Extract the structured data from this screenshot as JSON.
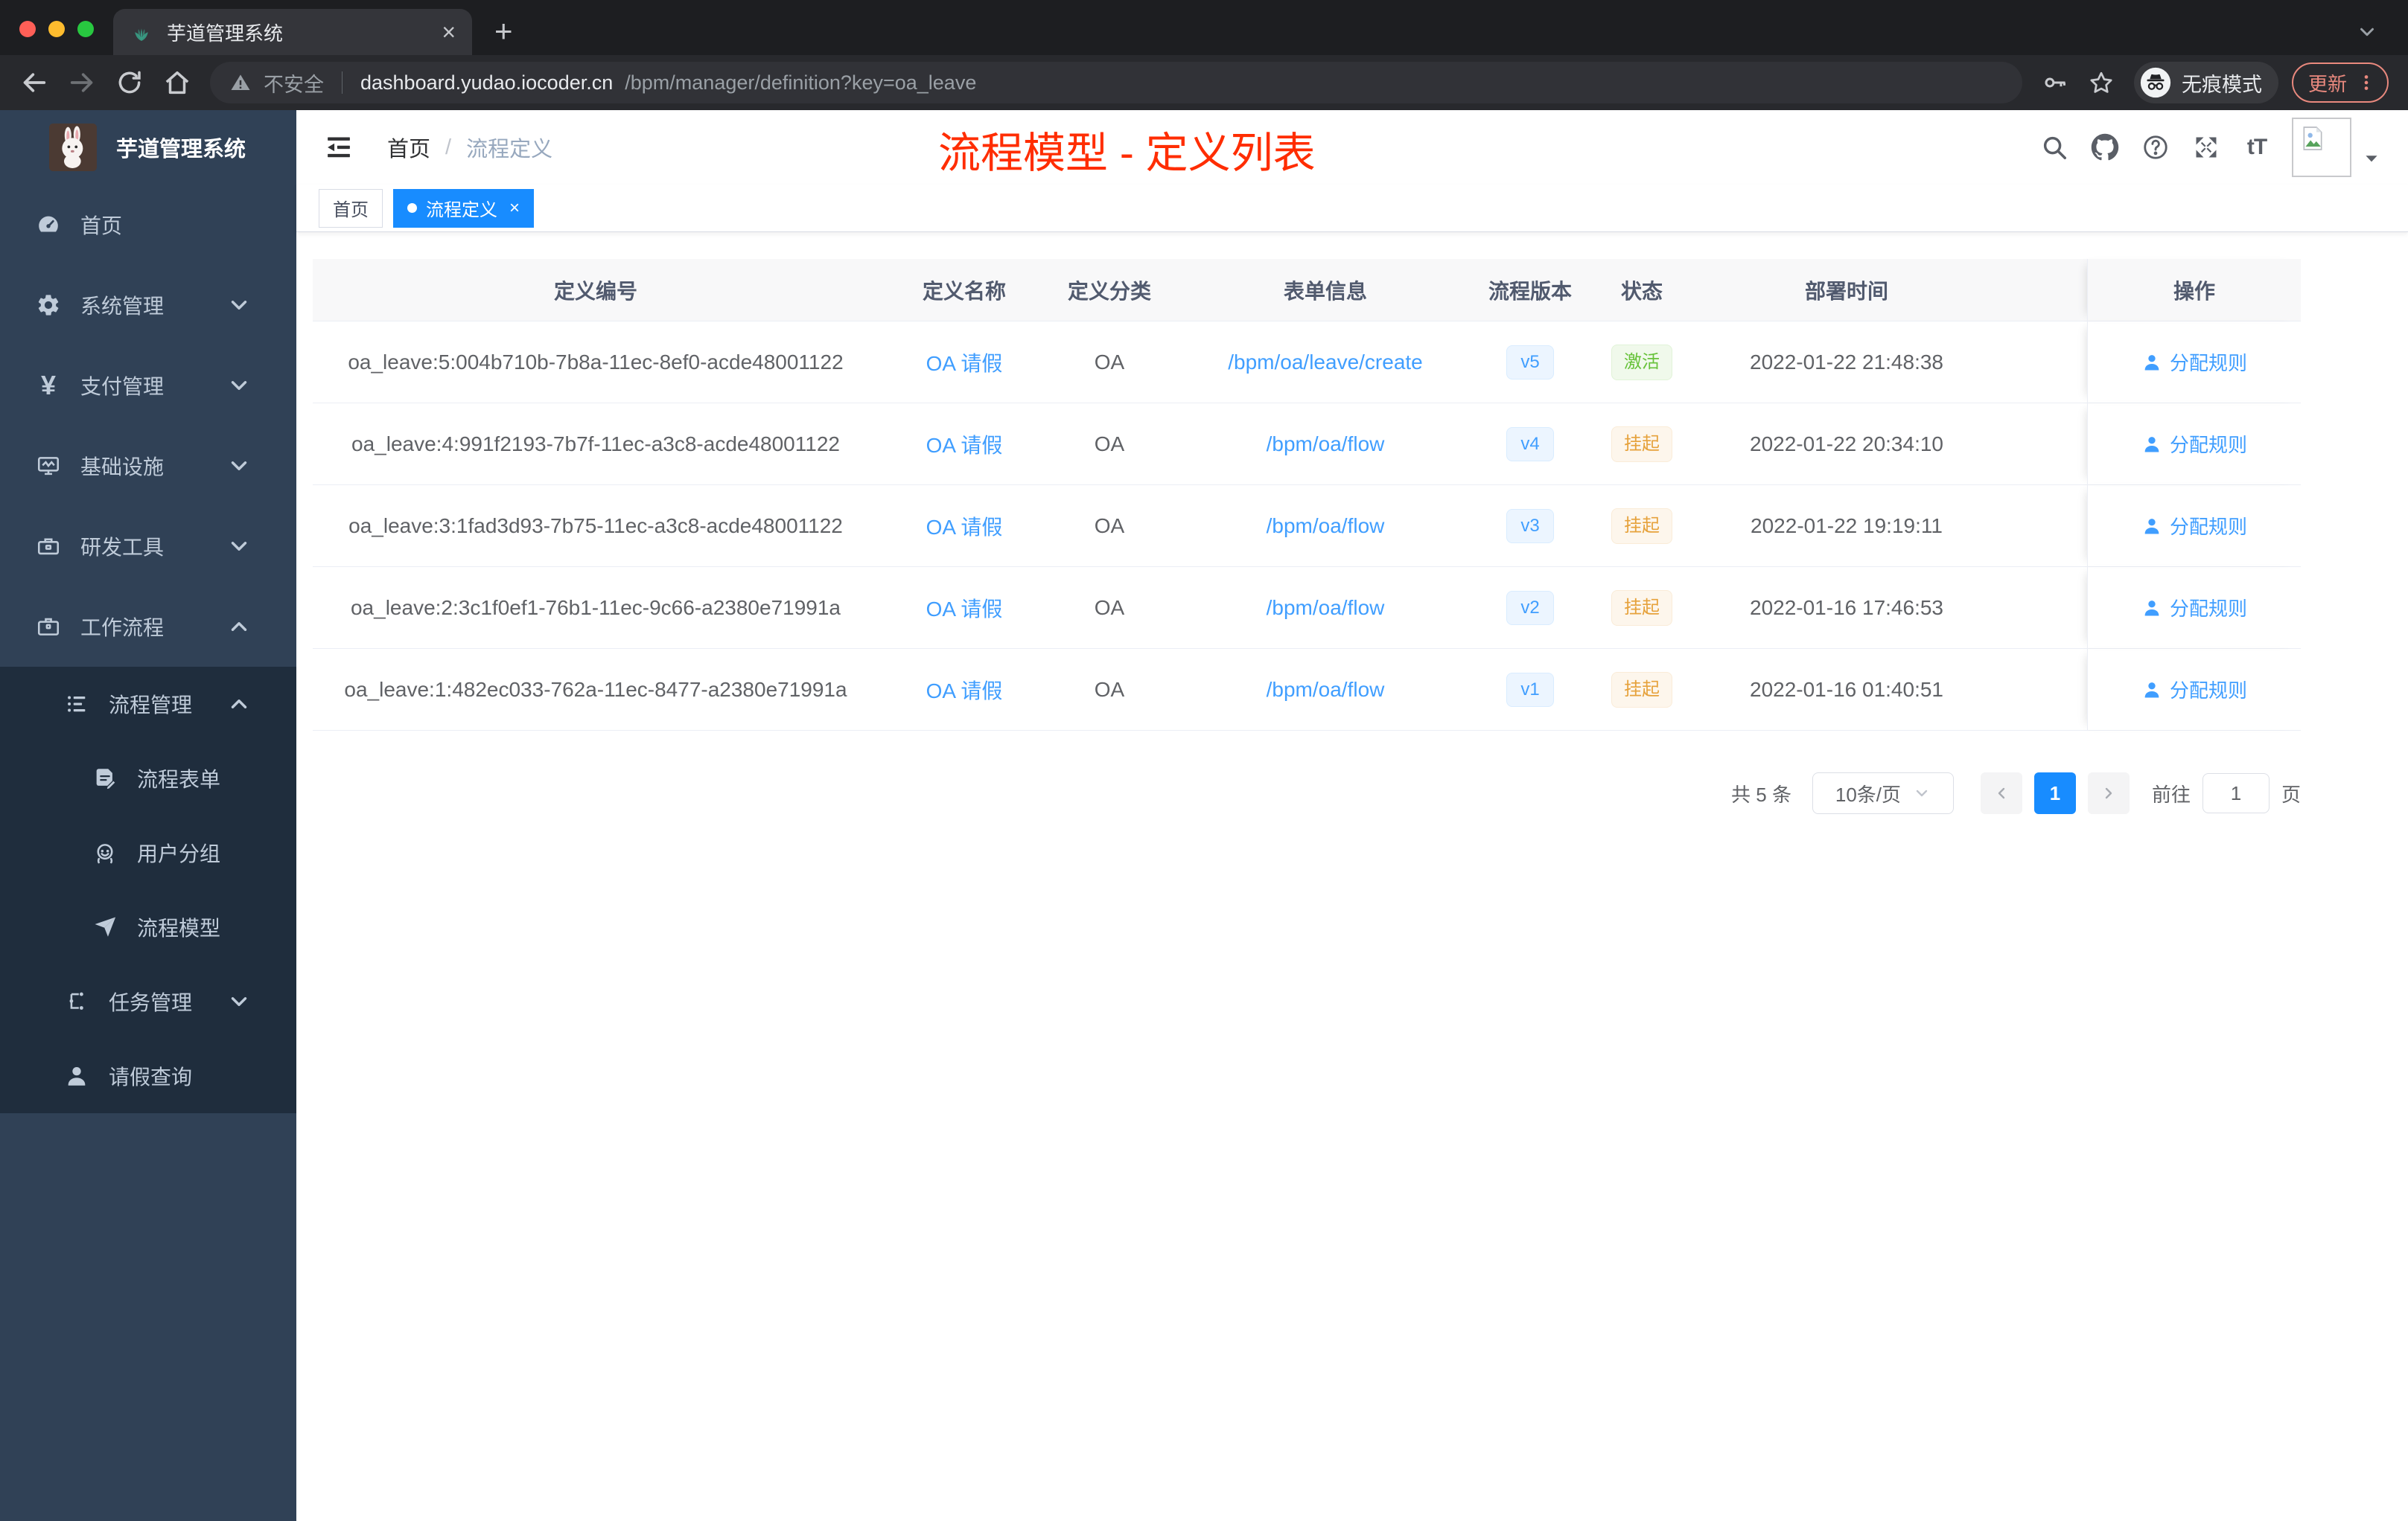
{
  "colors": {
    "accent_blue": "#409eff",
    "tag_active_blue": "#188cff",
    "annotation_red": "#ff2d00",
    "sidebar_bg": "#304156",
    "submenu_bg": "#1f2d3d",
    "status_active_green": "#67c23a",
    "status_suspend_orange": "#e6a23c",
    "update_salmon": "#e9897e"
  },
  "browser": {
    "favicon": "leaf-icon",
    "tab_title": "芋道管理系统",
    "new_tab_label": "+",
    "nav_icons": [
      "back-icon",
      "forward-icon",
      "reload-icon",
      "home-icon"
    ],
    "security_label": "不安全",
    "url_host": "dashboard.yudao.iocoder.cn",
    "url_path": "/bpm/manager/definition?key=oa_leave",
    "action_icons": [
      "key-icon",
      "star-icon"
    ],
    "incognito_label": "无痕模式",
    "update_label": "更新"
  },
  "sidebar": {
    "logo_icon": "bunny-logo",
    "logo_title": "芋道管理系统",
    "items": [
      {
        "key": "home",
        "label": "首页",
        "icon": "dashboard-icon",
        "level": 1
      },
      {
        "key": "system",
        "label": "系统管理",
        "icon": "gear-icon",
        "level": 1,
        "chevron": "down"
      },
      {
        "key": "payment",
        "label": "支付管理",
        "icon": "yen-icon",
        "level": 1,
        "chevron": "down"
      },
      {
        "key": "infra",
        "label": "基础设施",
        "icon": "monitor-icon",
        "level": 1,
        "chevron": "down"
      },
      {
        "key": "devtools",
        "label": "研发工具",
        "icon": "toolbox-icon",
        "level": 1,
        "chevron": "down"
      },
      {
        "key": "workflow",
        "label": "工作流程",
        "icon": "briefcase-icon",
        "level": 1,
        "chevron": "up"
      },
      {
        "key": "process-mgmt",
        "label": "流程管理",
        "icon": "list-icon",
        "level": 2,
        "chevron": "up"
      },
      {
        "key": "process-form",
        "label": "流程表单",
        "icon": "form-edit-icon",
        "level": 3
      },
      {
        "key": "user-group",
        "label": "用户分组",
        "icon": "user-group-icon",
        "level": 3
      },
      {
        "key": "process-model",
        "label": "流程模型",
        "icon": "paper-plane-icon",
        "level": 3
      },
      {
        "key": "task-mgmt",
        "label": "任务管理",
        "icon": "flow-tree-icon",
        "level": 2,
        "chevron": "down"
      },
      {
        "key": "leave-query",
        "label": "请假查询",
        "icon": "person-icon",
        "level": 2
      }
    ]
  },
  "header": {
    "breadcrumb": [
      "首页",
      "流程定义"
    ],
    "breadcrumb_separator": "/",
    "annotation": "流程模型 - 定义列表",
    "icons": [
      "search-icon",
      "github-icon",
      "help-icon",
      "fullscreen-icon",
      "font-size-icon"
    ],
    "avatar_icon": "image-placeholder-icon"
  },
  "tags": [
    {
      "label": "首页",
      "active": false,
      "closable": false
    },
    {
      "label": "流程定义",
      "active": true,
      "closable": true
    }
  ],
  "table": {
    "columns": [
      {
        "label": "定义编号",
        "class": "cell-id"
      },
      {
        "label": "定义名称",
        "class": "cell-name"
      },
      {
        "label": "定义分类",
        "class": "cell-cat"
      },
      {
        "label": "表单信息",
        "class": "cell-form"
      },
      {
        "label": "流程版本",
        "class": "cell-ver"
      },
      {
        "label": "状态",
        "class": "cell-status"
      },
      {
        "label": "部署时间",
        "class": "cell-time"
      },
      {
        "label": "操作",
        "class": "cell-op"
      }
    ],
    "action_label": "分配规则",
    "action_icon": "person-icon",
    "rows": [
      {
        "id": "oa_leave:5:004b710b-7b8a-11ec-8ef0-acde48001122",
        "name": "OA 请假",
        "category": "OA",
        "form": "/bpm/oa/leave/create",
        "version": "v5",
        "status": {
          "label": "激活",
          "type": "success"
        },
        "deployed_at": "2022-01-22 21:48:38"
      },
      {
        "id": "oa_leave:4:991f2193-7b7f-11ec-a3c8-acde48001122",
        "name": "OA 请假",
        "category": "OA",
        "form": "/bpm/oa/flow",
        "version": "v4",
        "status": {
          "label": "挂起",
          "type": "warning"
        },
        "deployed_at": "2022-01-22 20:34:10"
      },
      {
        "id": "oa_leave:3:1fad3d93-7b75-11ec-a3c8-acde48001122",
        "name": "OA 请假",
        "category": "OA",
        "form": "/bpm/oa/flow",
        "version": "v3",
        "status": {
          "label": "挂起",
          "type": "warning"
        },
        "deployed_at": "2022-01-22 19:19:11"
      },
      {
        "id": "oa_leave:2:3c1f0ef1-76b1-11ec-9c66-a2380e71991a",
        "name": "OA 请假",
        "category": "OA",
        "form": "/bpm/oa/flow",
        "version": "v2",
        "status": {
          "label": "挂起",
          "type": "warning"
        },
        "deployed_at": "2022-01-16 17:46:53"
      },
      {
        "id": "oa_leave:1:482ec033-762a-11ec-8477-a2380e71991a",
        "name": "OA 请假",
        "category": "OA",
        "form": "/bpm/oa/flow",
        "version": "v1",
        "status": {
          "label": "挂起",
          "type": "warning"
        },
        "deployed_at": "2022-01-16 01:40:51"
      }
    ]
  },
  "pagination": {
    "total_label": "共 5 条",
    "page_size": "10条/页",
    "active_page": "1",
    "goto_label": "前往",
    "goto_value": "1",
    "page_suffix": "页"
  }
}
